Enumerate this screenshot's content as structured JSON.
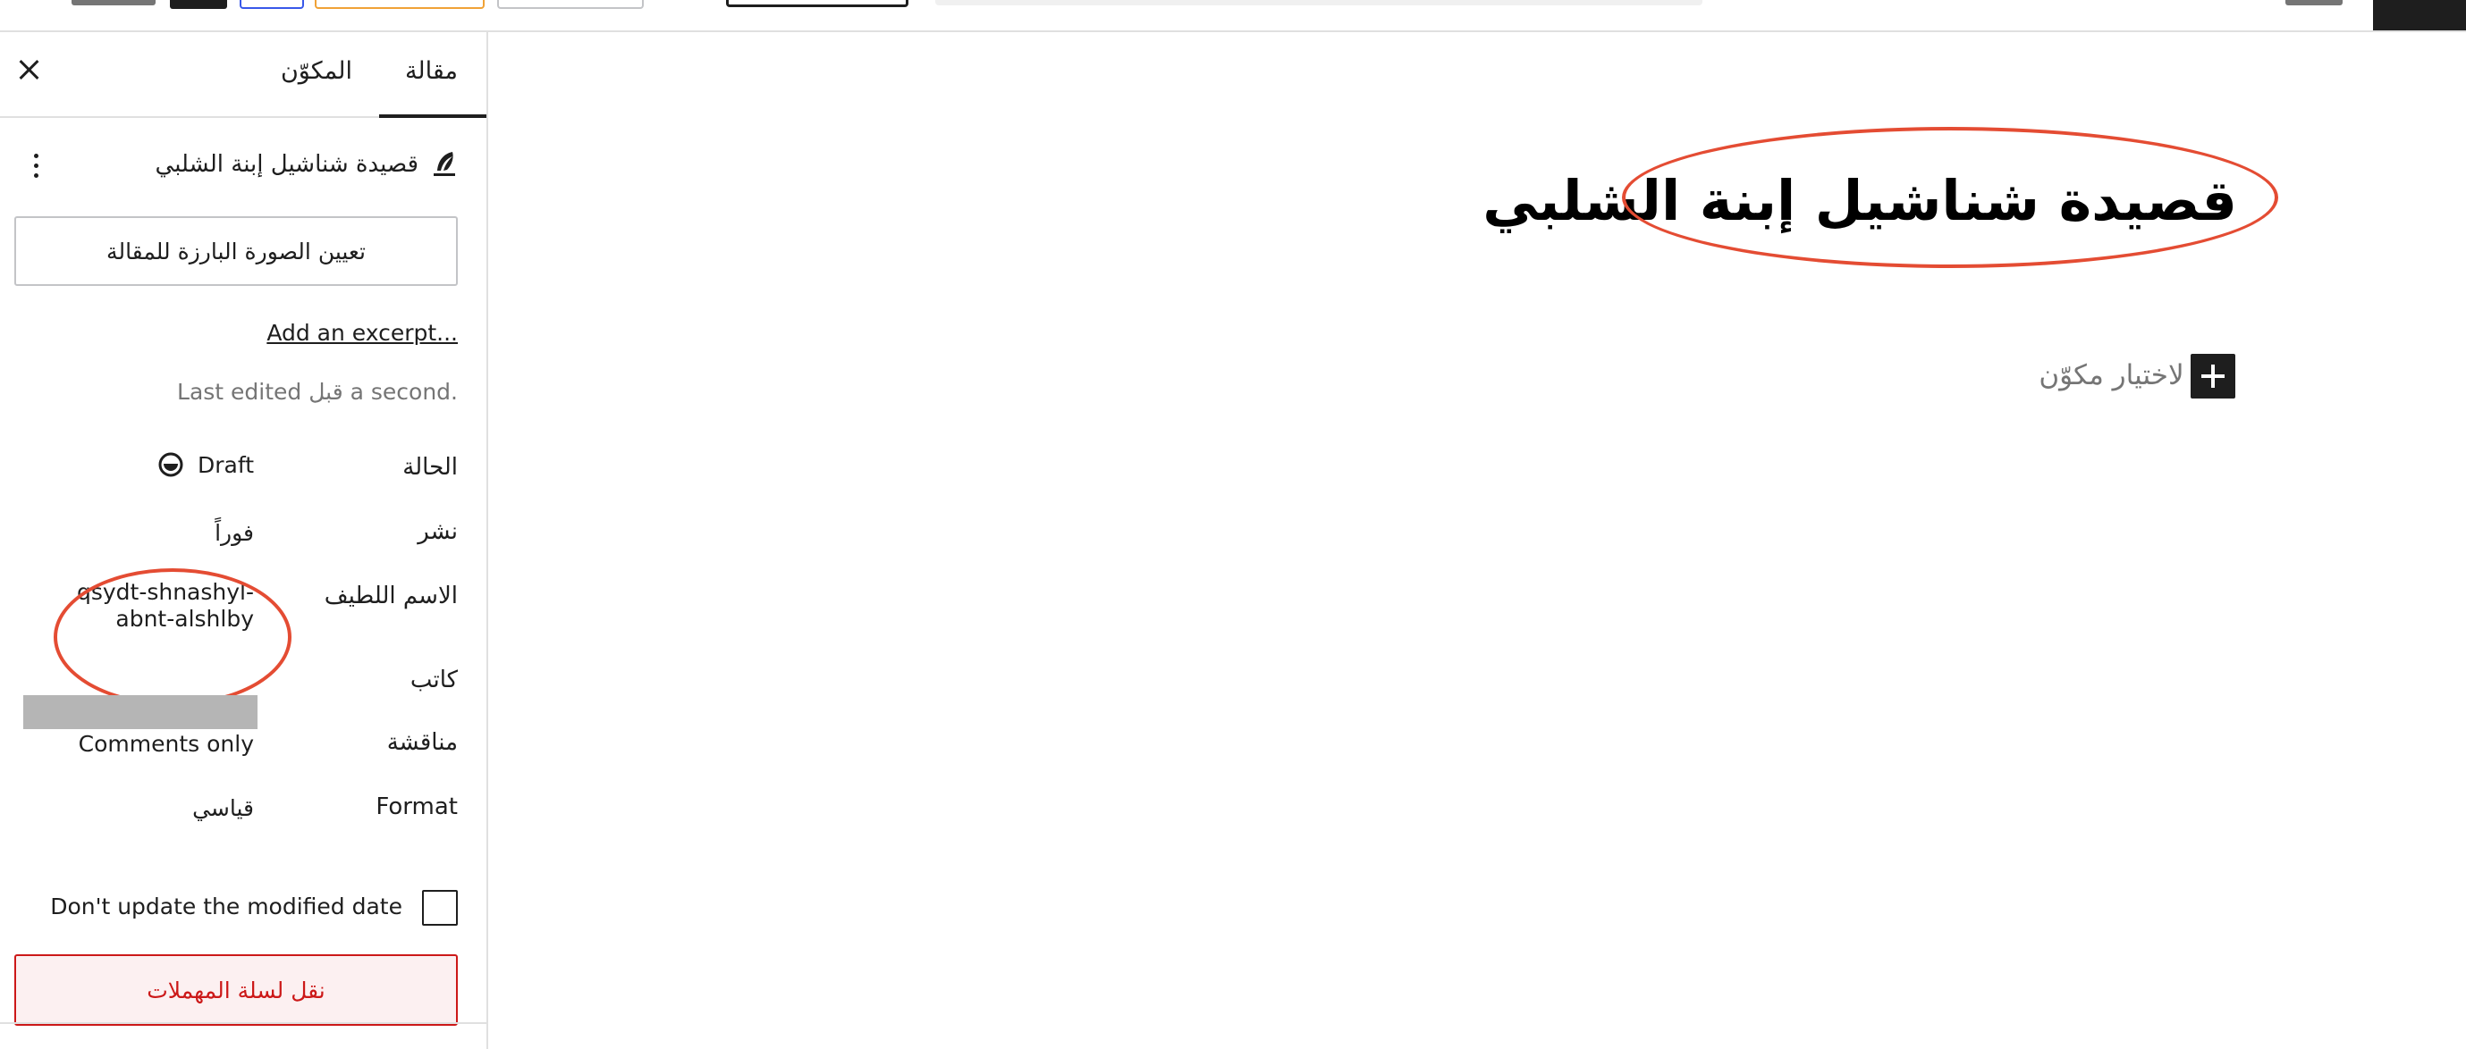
{
  "sidebar": {
    "tabs": [
      {
        "label": "مقالة"
      },
      {
        "label": "المكوّن"
      }
    ],
    "post_title": "قصيدة شناشيل إبنة الشلبي",
    "featured_image_label": "تعيين الصورة البارزة للمقالة",
    "excerpt_link": "Add an excerpt...",
    "last_edited": "Last edited قبل a second.",
    "rows": {
      "status": {
        "label": "الحالة",
        "value": "Draft"
      },
      "publish": {
        "label": "نشر",
        "value": "فوراً"
      },
      "slug": {
        "label": "الاسم اللطيف",
        "value": "qsydt-shnashyl-abnt-alshlby"
      },
      "author": {
        "label": "كاتب"
      },
      "discussion": {
        "label": "مناقشة",
        "value": "Comments only"
      },
      "format": {
        "label": "Format",
        "value": "قياسي"
      }
    },
    "modified_date_label": "Don't update the modified date",
    "trash_label": "نقل لسلة المهملات"
  },
  "editor": {
    "title": "قصيدة شناشيل إبنة الشلبي",
    "block_placeholder": "ب / لاختيار مكوّن"
  },
  "icons": {
    "close": "close-icon",
    "post": "feather-icon",
    "more": "more-vertical-icon",
    "status": "status-draft-icon",
    "add_block": "plus-icon"
  },
  "colors": {
    "annotation": "#e44c33",
    "danger": "#cc1818",
    "danger_bg": "#fcf0f1",
    "text": "#1e1e1e",
    "muted": "#757575"
  }
}
